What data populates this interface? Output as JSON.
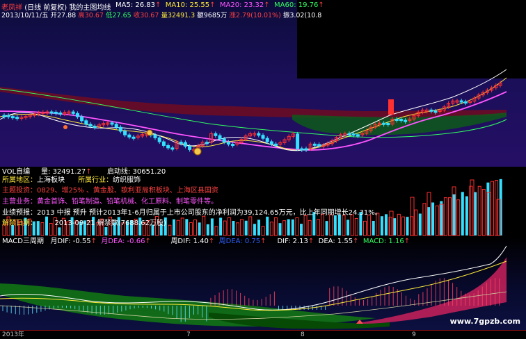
{
  "header": {
    "app_name": "老凤祥",
    "period": "(日线 前复权)",
    "indicator_name": "我的主图均线",
    "ma": [
      {
        "label": "MA5: 26.83",
        "arrow": "↑",
        "color": "#ffffff"
      },
      {
        "label": "MA10: 25.55",
        "arrow": "↑",
        "color": "#ffea3a"
      },
      {
        "label": "MA20: 23.32",
        "arrow": "↑",
        "color": "#ff55ff"
      },
      {
        "label": "MA60: 19.76",
        "arrow": "↑",
        "color": "#30ff60"
      }
    ]
  },
  "quote_line": {
    "date": "2013/10/11/五",
    "open": "开27.88",
    "high": "高30.67",
    "low": "低27.65",
    "close": "收30.67",
    "volume": "量32491.3",
    "amount": "额9685万",
    "change": "涨2.79(10.01%)",
    "amplitude": "振3.02(10.8"
  },
  "volume_header": {
    "title": "VOL自编",
    "volume": "量: 32491.27",
    "volume_arrow": "↑",
    "start_line": "启动线: 30651.20"
  },
  "stock_info": {
    "region_label": "所属地区：",
    "region_value": "上海板块",
    "industry_label": "所属行业：",
    "industry_value": "纺织服饰",
    "concept_label": "主题投资：",
    "concept_value": "0829、增25% 、黄金股、歌利亚局积板块、上海区县国资",
    "business_label": "主营业务：",
    "business_value": "黄金首饰、铅笔制造、铅笔机械、化工原料、制笔零件等。",
    "forecast_label": "业绩预报：",
    "forecast_value": "2013 中报 预升 预计2013年1-6月归属于上市公司股东的净利润为39,124.65万元，比上年同期增长24.31%。",
    "unlock_label": "解禁日期：",
    "unlock_value": "2013-09-21 解禁数(7688.62万股)"
  },
  "macd_header": {
    "title": "MACD三周期",
    "month_dif": "月DIF: -0.55",
    "month_dea": "月DEA: -0.66",
    "week_dif": "周DIF: 1.40",
    "week_dea": "周DEA: 0.75",
    "dif": "DIF: 2.13",
    "dea": "DEA: 1.55",
    "macd": "MACD: 1.16",
    "arrow": "↑"
  },
  "time_axis": {
    "labels": [
      "2013年",
      "7",
      "8",
      "9"
    ]
  },
  "watermark": "www.7gpzb.com",
  "colors": {
    "up": "#ff3030",
    "down": "#33e0ff",
    "ma5": "#ffffff",
    "ma10": "#ffea3a",
    "ma20": "#ff55ff",
    "ma60": "#30ff60",
    "band_red": "#8a1020",
    "band_green": "#0f5a18"
  }
}
